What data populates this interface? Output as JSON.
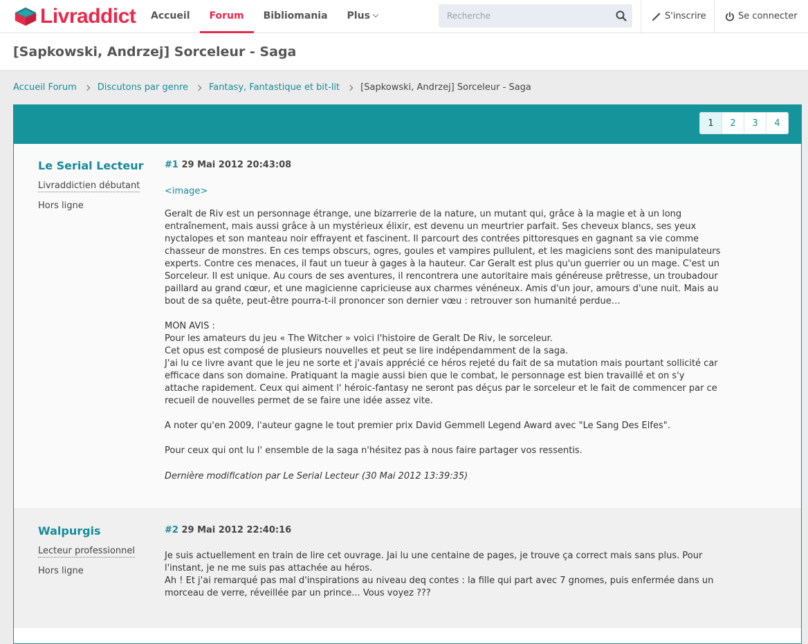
{
  "brand": {
    "part1": "Livr",
    "part2": "addict",
    "colors": {
      "accent": "#e8294b",
      "teal": "#168b99",
      "header": "#16949b"
    }
  },
  "nav": {
    "items": [
      {
        "label": "Accueil"
      },
      {
        "label": "Forum",
        "active": true
      },
      {
        "label": "Bibliomania"
      },
      {
        "label": "Plus"
      }
    ],
    "search_placeholder": "Recherche",
    "signup": "S'inscrire",
    "login": "Se connecter"
  },
  "page_title": "[Sapkowski, Andrzej] Sorceleur - Saga",
  "breadcrumb": [
    "Accueil Forum",
    "Discutons par genre",
    "Fantasy, Fantastique et bit-lit",
    "[Sapkowski, Andrzej] Sorceleur - Saga"
  ],
  "pagination": {
    "pages": [
      "1",
      "2",
      "3",
      "4"
    ],
    "current": "1"
  },
  "posts": [
    {
      "author": "Le Serial Lecteur",
      "rank": "Livraddictien débutant",
      "status": "Hors ligne",
      "number": "#1",
      "date": "29 Mai 2012 20:43:08",
      "image": "<image>",
      "paragraphs": [
        "Geralt de Riv est un personnage étrange, une bizarrerie de la nature, un mutant qui, grâce à la magie et à un long entraînement, mais aussi grâce à un mystérieux élixir, est devenu un meurtrier parfait. Ses cheveux blancs, ses yeux nyctalopes et son manteau noir effrayent et fascinent. Il parcourt des contrées pittoresques en gagnant sa vie comme chasseur de monstres. En ces temps obscurs, ogres, goules et vampires pullulent, et les magiciens sont des manipulateurs experts. Contre ces menaces, il faut un tueur à gages à la hauteur. Car Geralt est plus qu'un guerrier ou un mage. C'est un Sorceleur. Il est unique. Au cours de ses aventures, il rencontrera une autoritaire mais généreuse prêtresse, un troubadour paillard au grand cœur, et une magicienne capricieuse aux charmes vénéneux. Amis d'un jour, amours d'une nuit. Mais au bout de sa quête, peut-être pourra-t-il prononcer son dernier vœu : retrouver son humanité perdue…",
        "MON AVIS :",
        "Pour les amateurs du jeu « The Witcher » voici l'histoire de Geralt De Riv, le sorceleur.",
        "Cet opus est composé de plusieurs nouvelles et peut se lire indépendamment de la saga.",
        "J'ai lu ce livre avant que le jeu ne sorte et j'avais apprécié ce héros rejeté du fait de sa mutation mais pourtant sollicité car efficace dans son domaine. Pratiquant la magie aussi bien que le combat, le personnage est bien travaillé et on s'y attache rapidement. Ceux qui aiment l' héroic-fantasy ne seront pas déçus par le sorceleur et le fait de commencer par ce recueil de nouvelles permet de se faire une idée assez vite.",
        "A noter qu'en 2009, l'auteur gagne le tout premier prix David Gemmell Legend Award avec \"Le Sang Des Elfes\".",
        "Pour ceux qui ont lu l' ensemble de la saga n'hésitez pas à nous faire partager vos ressentis."
      ],
      "modification": "Dernière modification par Le Serial Lecteur (30 Mai 2012 13:39:35)"
    },
    {
      "author": "Walpurgis",
      "rank": "Lecteur professionnel",
      "status": "Hors ligne",
      "number": "#2",
      "date": "29 Mai 2012 22:40:16",
      "paragraphs": [
        "Je suis actuellement en train de lire cet ouvrage. Jai lu une centaine de pages, je trouve ça correct mais sans plus. Pour l'instant, je ne me suis pas attachée au héros.",
        "Ah ! Et j'ai remarqué pas mal d'inspirations au niveau deq contes : la fille qui part avec 7 gnomes, puis enfermée dans un morceau de verre, réveillée par un prince... Vous voyez ???"
      ]
    }
  ]
}
